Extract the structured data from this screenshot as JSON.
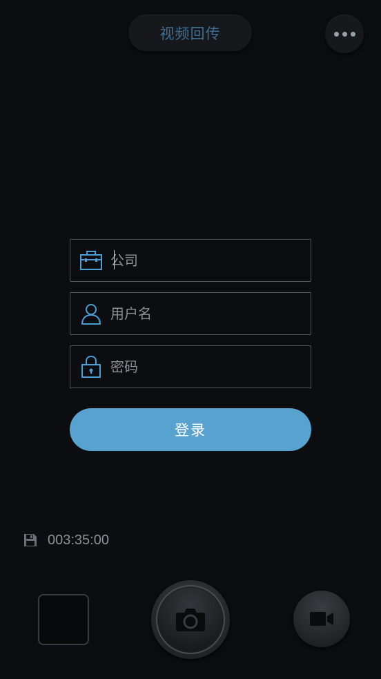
{
  "header": {
    "mode_label": "视频回传",
    "more_icon": "more-dots-icon"
  },
  "login_form": {
    "company": {
      "placeholder": "公司",
      "value": "",
      "icon": "briefcase-icon"
    },
    "username": {
      "placeholder": "用户名",
      "value": "",
      "icon": "user-icon"
    },
    "password": {
      "placeholder": "密码",
      "value": "",
      "icon": "lock-icon"
    },
    "submit_label": "登录"
  },
  "storage": {
    "icon": "save-disk-icon",
    "remaining_time": "003:35:00"
  },
  "controls": {
    "gallery_icon": "gallery-thumbnail",
    "shutter_icon": "camera-icon",
    "video_icon": "video-camera-icon"
  },
  "colors": {
    "background": "#0c0d10",
    "accent": "#58a2cf",
    "icon_blue": "#4a9fd4",
    "mode_text": "#3d6e94"
  }
}
